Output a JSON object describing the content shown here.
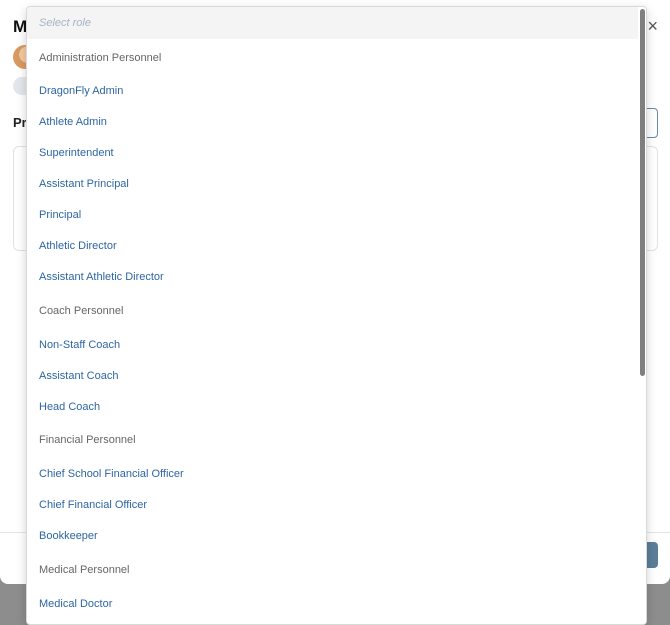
{
  "modal": {
    "title": "M",
    "close_label": "×",
    "section_label": "Pr"
  },
  "dropdown": {
    "search_placeholder": "Select role",
    "options": [
      {
        "label": "Administration Personnel",
        "type": "group"
      },
      {
        "label": "DragonFly Admin",
        "type": "item"
      },
      {
        "label": "Athlete Admin",
        "type": "item"
      },
      {
        "label": "Superintendent",
        "type": "item"
      },
      {
        "label": "Assistant Principal",
        "type": "item"
      },
      {
        "label": "Principal",
        "type": "item"
      },
      {
        "label": "Athletic Director",
        "type": "item"
      },
      {
        "label": "Assistant Athletic Director",
        "type": "item"
      },
      {
        "label": "Coach Personnel",
        "type": "group"
      },
      {
        "label": "Non-Staff Coach",
        "type": "item"
      },
      {
        "label": "Assistant Coach",
        "type": "item"
      },
      {
        "label": "Head Coach",
        "type": "item"
      },
      {
        "label": "Financial Personnel",
        "type": "group"
      },
      {
        "label": "Chief School Financial Officer",
        "type": "item"
      },
      {
        "label": "Chief Financial Officer",
        "type": "item"
      },
      {
        "label": "Bookkeeper",
        "type": "item"
      },
      {
        "label": "Medical Personnel",
        "type": "group"
      },
      {
        "label": "Medical Doctor",
        "type": "item"
      }
    ]
  },
  "colors": {
    "option_link": "#2e65a3",
    "group_header": "#666666",
    "placeholder": "#a5b4c4"
  }
}
